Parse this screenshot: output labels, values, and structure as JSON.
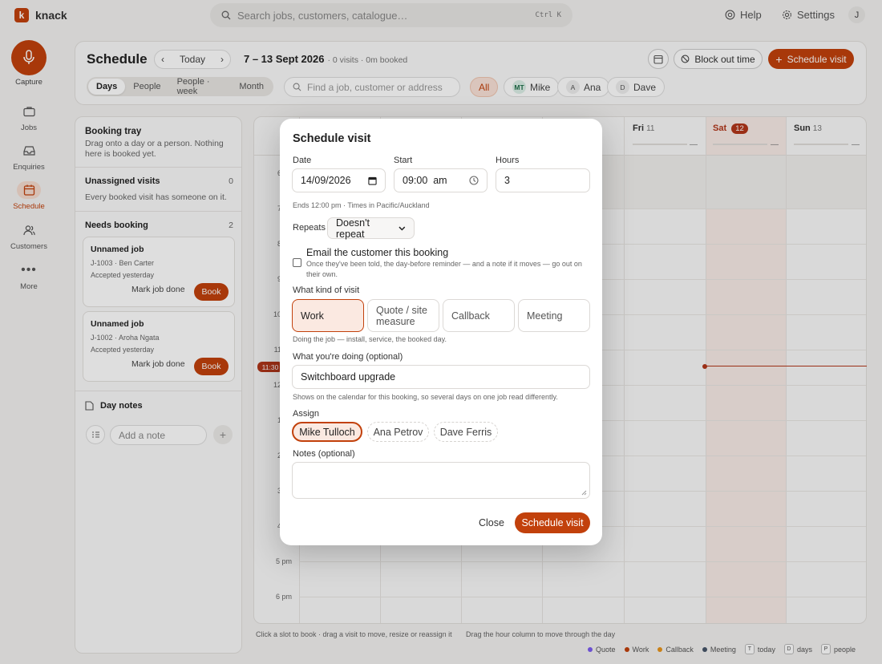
{
  "app": {
    "name": "knack",
    "logo_letter": "k"
  },
  "search": {
    "placeholder": "Search jobs, customers, catalogue…",
    "shortcut": "Ctrl K"
  },
  "topbar": {
    "help": "Help",
    "settings": "Settings",
    "avatar": "J"
  },
  "sidebar": {
    "capture_label": "Capture",
    "items": [
      {
        "label": "Jobs",
        "icon": "briefcase-icon"
      },
      {
        "label": "Enquiries",
        "icon": "inbox-icon"
      },
      {
        "label": "Schedule",
        "icon": "calendar-icon",
        "active": true
      },
      {
        "label": "Customers",
        "icon": "people-icon"
      },
      {
        "label": "More",
        "icon": "more-icon"
      }
    ]
  },
  "header": {
    "title": "Schedule",
    "today": "Today",
    "range": "7 – 13 Sept 2026",
    "summary": "· 0 visits · 0m booked",
    "block_out": "Block out time",
    "schedule_visit": "Schedule visit",
    "view_tabs": [
      "Days",
      "People",
      "People · week",
      "Month"
    ],
    "find_placeholder": "Find a job, customer or address",
    "filters": [
      {
        "label": "All",
        "initials": ""
      },
      {
        "label": "Mike",
        "initials": "MT"
      },
      {
        "label": "Ana",
        "initials": "A"
      },
      {
        "label": "Dave",
        "initials": "D"
      }
    ]
  },
  "tray": {
    "title": "Booking tray",
    "subtitle": "Drag onto a day or a person. Nothing here is booked yet.",
    "unassigned": {
      "title": "Unassigned visits",
      "count": "0",
      "note": "Every booked visit has someone on it."
    },
    "needs_booking": {
      "title": "Needs booking",
      "count": "2"
    },
    "jobs": [
      {
        "title": "Unnamed job",
        "ref": "J-1003 · Ben Carter",
        "status": "Accepted yesterday",
        "done": "Mark job done",
        "book": "Book"
      },
      {
        "title": "Unnamed job",
        "ref": "J-1002 · Aroha Ngata",
        "status": "Accepted yesterday",
        "done": "Mark job done",
        "book": "Book"
      }
    ],
    "day_notes": "Day notes",
    "note_placeholder": "Add a note"
  },
  "calendar": {
    "days": [
      {
        "name": "Fri",
        "num": "11",
        "dash": "—"
      },
      {
        "name": "Sat",
        "num": "12",
        "dash": "—",
        "today": true
      },
      {
        "name": "Sun",
        "num": "13",
        "dash": "—"
      }
    ],
    "hours": [
      "6",
      "7",
      "8",
      "9",
      "10",
      "11",
      "12",
      "1",
      "2",
      "3",
      "4",
      "5 pm",
      "6 pm"
    ],
    "now": "11:30",
    "hint_left": "Click a slot to book · drag a visit to move, resize or reassign it",
    "hint_right": "Drag the hour column to move through the day"
  },
  "legend": {
    "items": [
      {
        "label": "Quote",
        "color": "#7c5cf0"
      },
      {
        "label": "Work",
        "color": "#c2410c"
      },
      {
        "label": "Callback",
        "color": "#e8931a"
      },
      {
        "label": "Meeting",
        "color": "#475569"
      }
    ],
    "shortcuts": [
      {
        "key": "T",
        "label": "today"
      },
      {
        "key": "D",
        "label": "days"
      },
      {
        "key": "P",
        "label": "people"
      }
    ]
  },
  "modal": {
    "title": "Schedule visit",
    "date_label": "Date",
    "date_value": "14/09/2026",
    "start_label": "Start",
    "start_value": "09:00  am",
    "hours_label": "Hours",
    "hours_value": "3",
    "ends_hint": "Ends 12:00 pm · Times in Pacific/Auckland",
    "repeats_label": "Repeats",
    "repeats_value": "Doesn't repeat",
    "email_label": "Email the customer this booking",
    "email_hint": "Once they've been told, the day-before reminder — and a note if it moves — go out on their own.",
    "kind_label": "What kind of visit",
    "kinds": [
      "Work",
      "Quote / site measure",
      "Callback",
      "Meeting"
    ],
    "kind_hint": "Doing the job — install, service, the booked day.",
    "doing_label": "What you're doing (optional)",
    "doing_value": "Switchboard upgrade",
    "doing_hint": "Shows on the calendar for this booking, so several days on one job read differently.",
    "assign_label": "Assign",
    "assignees": [
      "Mike Tulloch",
      "Ana Petrov",
      "Dave Ferris"
    ],
    "notes_label": "Notes (optional)",
    "close": "Close",
    "submit": "Schedule visit"
  },
  "colors": {
    "accent": "#c2410c",
    "accent_soft": "#fbe9e1",
    "now_line": "#b2361a"
  }
}
